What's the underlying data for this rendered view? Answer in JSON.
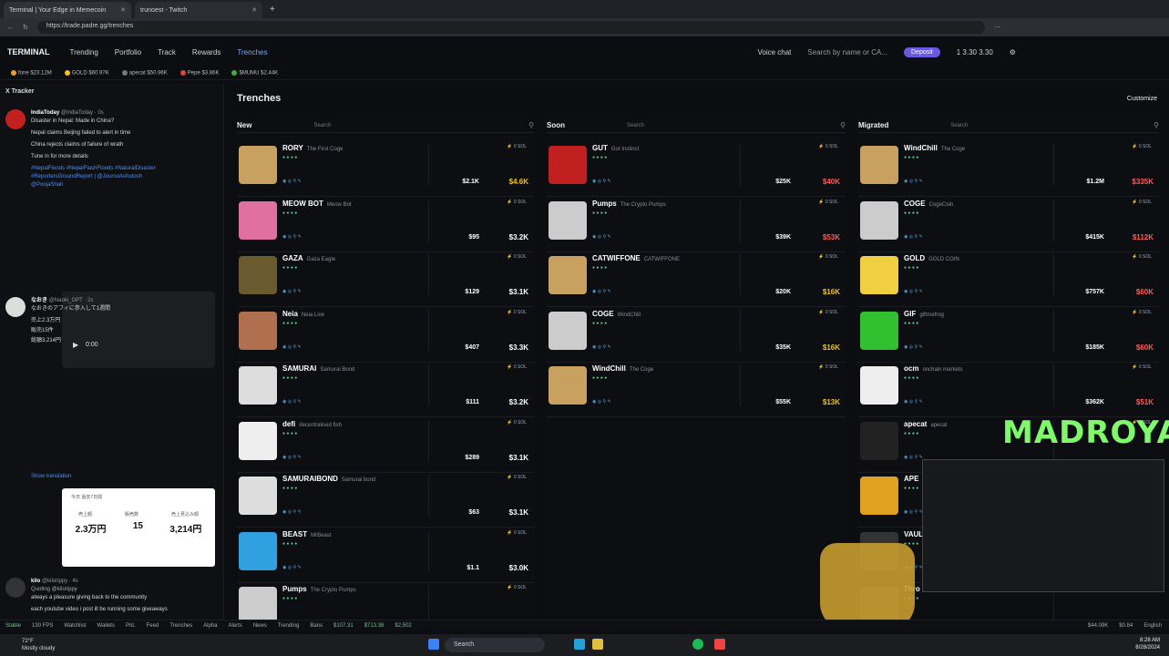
{
  "browser": {
    "tabs": [
      {
        "label": "Terminal | Your Edge in Memecoin"
      },
      {
        "label": "trunoest - Twitch"
      }
    ],
    "url": "https://trade.padre.gg/trenches"
  },
  "nav": {
    "logo": "TERMINAL",
    "items": [
      "Trending",
      "Portfolio",
      "Track",
      "Rewards",
      "Trenches"
    ],
    "voice": "Voice chat",
    "search": "Search by name or CA...",
    "deposit": "Deposit",
    "wallet": "1  3.30  3.30"
  },
  "ticker": [
    {
      "label": "fone $23.12M",
      "color": "#f0a020"
    },
    {
      "label": "GOLD $60.97K",
      "color": "#f0c419"
    },
    {
      "label": "apecat $50.96K",
      "color": "#777777"
    },
    {
      "label": "Pepe $3.86K",
      "color": "#d44"
    },
    {
      "label": "$MUMU $2.44K",
      "color": "#4a4"
    }
  ],
  "tracker": {
    "title": "X Tracker",
    "post1": {
      "name": "IndiaToday",
      "handle": "@IndiaToday · 0s",
      "lines": [
        "Disaster in Nepal: Made in China?",
        "Nepal claims Beijing failed to alert in time",
        "China rejects claims of failure of wrath",
        "Tune in for more details"
      ],
      "tags": "#NepalFloods #NepalFlashFloods #NaturalDisaster #ReportersGroundReport | @JournoAshutosh",
      "tag2": "@PoojaShali",
      "time": "0:00"
    },
    "post2": {
      "name": "なおき",
      "handle": "@Naoki_GPT · 2s",
      "lines": [
        "なおきのアフィに参入して1週間",
        "売上2.3万円",
        "販売15件",
        "総額3,214円"
      ],
      "translate": "Show translation",
      "card": {
        "tabs": [
          "今日",
          "過去7日間"
        ],
        "labels": [
          "売上額",
          "販売数",
          "売上見込み額"
        ],
        "values": [
          "2.3万円",
          "15",
          "3,214円"
        ]
      }
    },
    "post3": {
      "name": "kilo",
      "handle": "@kilorippy · 4s",
      "lines": [
        "Quoting @kilorippy",
        "always a pleasure giving back to the community",
        "each youtube video i post ill be running some giveaways"
      ]
    }
  },
  "trenches": {
    "title": "Trenches",
    "customize": "Customize"
  },
  "columns": [
    {
      "title": "New",
      "search": "Search",
      "rows": [
        {
          "name": "RORY",
          "sub": "The First Coge",
          "vol": "$2.1K",
          "mc": "$4.6K",
          "mccls": "",
          "color": "#c8a060"
        },
        {
          "name": "MEOW BOT",
          "sub": "Meow Bot",
          "vol": "$95",
          "mc": "$3.2K",
          "mccls": "white",
          "color": "#e070a0"
        },
        {
          "name": "GAZA",
          "sub": "Gaza Eagle",
          "vol": "$129",
          "mc": "$3.1K",
          "mccls": "white",
          "color": "#6a5a30"
        },
        {
          "name": "Neia",
          "sub": "Neia Live",
          "vol": "$407",
          "mc": "$3.3K",
          "mccls": "white",
          "color": "#b07050"
        },
        {
          "name": "SAMURAI",
          "sub": "Samurai Bond",
          "vol": "$111",
          "mc": "$3.2K",
          "mccls": "white",
          "color": "#ddd"
        },
        {
          "name": "defi",
          "sub": "decentralised fish",
          "vol": "$289",
          "mc": "$3.1K",
          "mccls": "white",
          "color": "#eee"
        },
        {
          "name": "SAMURAIBOND",
          "sub": "Samurai bond",
          "vol": "$63",
          "mc": "$3.1K",
          "mccls": "white",
          "color": "#ddd"
        },
        {
          "name": "BEAST",
          "sub": "MrBeast",
          "vol": "$1.1",
          "mc": "$3.0K",
          "mccls": "white",
          "color": "#30a0e0"
        },
        {
          "name": "Pumps",
          "sub": "The Crypto Pumps",
          "vol": "",
          "mc": "",
          "mccls": "white",
          "color": "#ccc"
        }
      ]
    },
    {
      "title": "Soon",
      "search": "Search",
      "rows": [
        {
          "name": "GUT",
          "sub": "Gut Instinct",
          "vol": "$25K",
          "mc": "$40K",
          "mccls": "red",
          "color": "#c02020"
        },
        {
          "name": "Pumps",
          "sub": "The Crypto Pumps",
          "vol": "$39K",
          "mc": "$53K",
          "mccls": "red",
          "color": "#ccc"
        },
        {
          "name": "CATWIFFONE",
          "sub": "CATWIFFONE",
          "vol": "$20K",
          "mc": "$16K",
          "mccls": "",
          "color": "#c8a060"
        },
        {
          "name": "COGE",
          "sub": "WindChill",
          "vol": "$35K",
          "mc": "$16K",
          "mccls": "",
          "color": "#ccc"
        },
        {
          "name": "WindChill",
          "sub": "The Coge",
          "vol": "$55K",
          "mc": "$13K",
          "mccls": "",
          "color": "#c8a060"
        }
      ]
    },
    {
      "title": "Migrated",
      "search": "Search",
      "rows": [
        {
          "name": "WindChill",
          "sub": "The Coge",
          "vol": "$1.2M",
          "mc": "$335K",
          "mccls": "red",
          "color": "#c8a060"
        },
        {
          "name": "COGE",
          "sub": "CogeCoin",
          "vol": "$415K",
          "mc": "$112K",
          "mccls": "red",
          "color": "#ccc"
        },
        {
          "name": "GOLD",
          "sub": "GOLD COIN",
          "vol": "$757K",
          "mc": "$60K",
          "mccls": "red",
          "color": "#f0d040"
        },
        {
          "name": "GIF",
          "sub": "giftmefrog",
          "vol": "$185K",
          "mc": "$60K",
          "mccls": "red",
          "color": "#30c030"
        },
        {
          "name": "ocm",
          "sub": "onchain markets",
          "vol": "$362K",
          "mc": "$51K",
          "mccls": "red",
          "color": "#eee"
        },
        {
          "name": "apecat",
          "sub": "apecat",
          "vol": "",
          "mc": "",
          "mccls": "",
          "color": "#222"
        },
        {
          "name": "APE",
          "sub": "",
          "vol": "",
          "mc": "",
          "mccls": "",
          "color": "#e0a020"
        },
        {
          "name": "VAUL",
          "sub": "",
          "vol": "",
          "mc": "",
          "mccls": "",
          "color": "#333"
        },
        {
          "name": "Thro",
          "sub": "",
          "vol": "",
          "mc": "",
          "mccls": "",
          "color": "#333"
        }
      ]
    }
  ],
  "overlay": {
    "streamer": "MADROYALS"
  },
  "status": {
    "items": [
      "Stable",
      "130 FPS",
      "Watchlist",
      "Wallets",
      "PnL",
      "Feed",
      "Trenches",
      "Alpha",
      "Alerts",
      "News",
      "Trending",
      "Bans"
    ],
    "prices": [
      "$107.31",
      "$713.38",
      "$2,502"
    ],
    "right": [
      "$44.09K",
      "$0.84",
      "English"
    ]
  },
  "taskbar": {
    "weather": "72°F",
    "weather2": "Mostly cloudy",
    "search": "Search",
    "time": "8:28 AM",
    "date": "8/28/2024"
  }
}
